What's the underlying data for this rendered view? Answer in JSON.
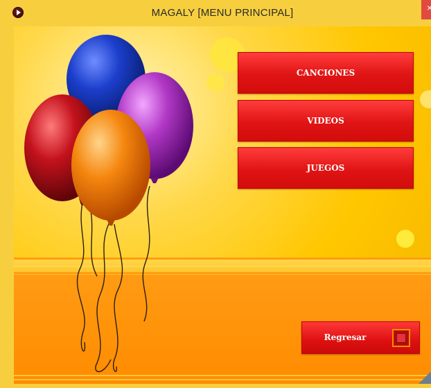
{
  "window": {
    "title": "MAGALY [MENU PRINCIPAL]",
    "close_label": "×"
  },
  "menu": {
    "buttons": [
      {
        "label": "CANCIONES"
      },
      {
        "label": "VIDEOS"
      },
      {
        "label": "JUEGOS"
      }
    ]
  },
  "footer": {
    "back_label": "Regresar"
  },
  "colors": {
    "background": "#ffc700",
    "button_red": "#e01414",
    "bottom_band": "#ff8c00",
    "balloon_blue": "#1238b8",
    "balloon_purple": "#a52fb4",
    "balloon_red": "#c4121d",
    "balloon_orange": "#f07a10"
  },
  "icons": {
    "app": "play-circle-icon",
    "back": "stop-square-icon",
    "close": "close-icon"
  }
}
